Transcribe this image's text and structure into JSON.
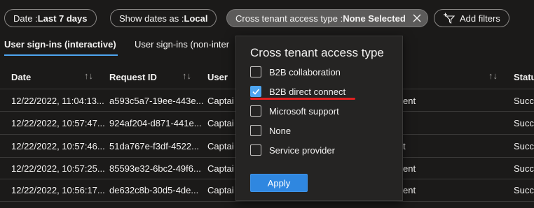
{
  "filters": {
    "date": {
      "prefix": "Date : ",
      "value": "Last 7 days"
    },
    "show_dates": {
      "prefix": "Show dates as : ",
      "value": "Local"
    },
    "cross_tenant": {
      "prefix": "Cross tenant access type : ",
      "value": "None Selected"
    },
    "add_filters": "Add filters"
  },
  "tabs": [
    {
      "label": "User sign-ins (interactive)"
    },
    {
      "label": "User sign-ins (non-inter"
    }
  ],
  "table": {
    "headers": {
      "date": "Date",
      "request_id": "Request ID",
      "user": "User",
      "status": "Statu"
    },
    "sort_glyph": "↑↓",
    "rows": [
      {
        "date": "12/22/2022, 11:04:13...",
        "request_id": "a593c5a7-19ee-443e...",
        "user": "Captai",
        "app": "ent",
        "status": "Succe"
      },
      {
        "date": "12/22/2022, 10:57:47...",
        "request_id": "924af204-d871-441e...",
        "user": "Captai",
        "app": "",
        "status": "Succe"
      },
      {
        "date": "12/22/2022, 10:57:46...",
        "request_id": "51da767e-f3df-4522...",
        "user": "Captai",
        "app": "t",
        "status": "Succe"
      },
      {
        "date": "12/22/2022, 10:57:25...",
        "request_id": "85593e32-6bc2-49f6...",
        "user": "Captai",
        "app": "ent",
        "status": "Succe"
      },
      {
        "date": "12/22/2022, 10:56:17...",
        "request_id": "de632c8b-30d5-4de...",
        "user": "Captai",
        "app": "ent",
        "status": "Succe"
      }
    ]
  },
  "dropdown": {
    "title": "Cross tenant access type",
    "options": [
      {
        "label": "B2B collaboration",
        "checked": false
      },
      {
        "label": "B2B direct connect",
        "checked": true
      },
      {
        "label": "Microsoft support",
        "checked": false
      },
      {
        "label": "None",
        "checked": false
      },
      {
        "label": "Service provider",
        "checked": false
      }
    ],
    "apply_label": "Apply"
  },
  "colors": {
    "accent": "#4ea5f0",
    "apply_button": "#2f87e0",
    "annotation_red": "#e02020"
  }
}
